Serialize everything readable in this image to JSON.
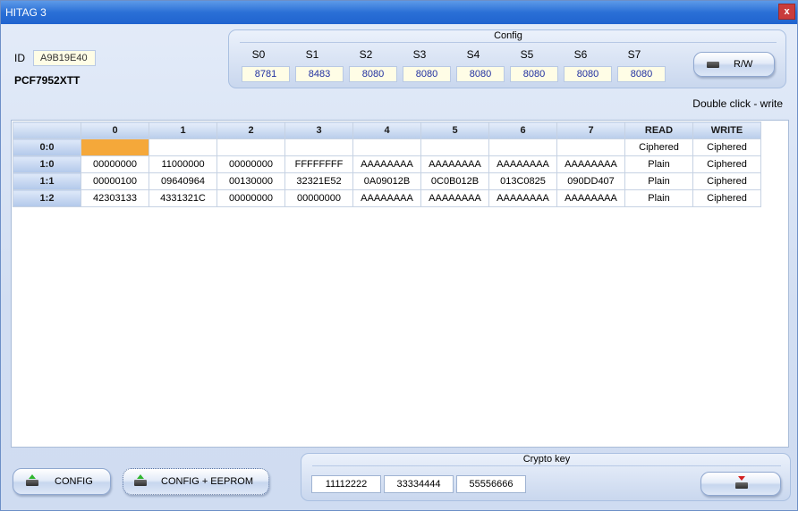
{
  "window": {
    "title": "HITAG 3",
    "close_label": "x"
  },
  "id_label": "ID",
  "id_value": "A9B19E40",
  "part_number": "PCF7952XTT",
  "config": {
    "title": "Config",
    "columns": [
      {
        "label": "S0",
        "value": "8781"
      },
      {
        "label": "S1",
        "value": "8483"
      },
      {
        "label": "S2",
        "value": "8080"
      },
      {
        "label": "S3",
        "value": "8080"
      },
      {
        "label": "S4",
        "value": "8080"
      },
      {
        "label": "S5",
        "value": "8080"
      },
      {
        "label": "S6",
        "value": "8080"
      },
      {
        "label": "S7",
        "value": "8080"
      }
    ],
    "rw_label": "R/W"
  },
  "hint": "Double click - write",
  "grid": {
    "headers": [
      "0",
      "1",
      "2",
      "3",
      "4",
      "5",
      "6",
      "7",
      "READ",
      "WRITE"
    ],
    "rows": [
      {
        "label": "0:0",
        "cells": [
          "",
          "",
          "",
          "",
          "",
          "",
          "",
          "",
          "Ciphered",
          "Ciphered"
        ]
      },
      {
        "label": "1:0",
        "cells": [
          "00000000",
          "11000000",
          "00000000",
          "FFFFFFFF",
          "AAAAAAAA",
          "AAAAAAAA",
          "AAAAAAAA",
          "AAAAAAAA",
          "Plain",
          "Ciphered"
        ]
      },
      {
        "label": "1:1",
        "cells": [
          "00000100",
          "09640964",
          "00130000",
          "32321E52",
          "0A09012B",
          "0C0B012B",
          "013C0825",
          "090DD407",
          "Plain",
          "Ciphered"
        ]
      },
      {
        "label": "1:2",
        "cells": [
          "42303133",
          "4331321C",
          "00000000",
          "00000000",
          "AAAAAAAA",
          "AAAAAAAA",
          "AAAAAAAA",
          "AAAAAAAA",
          "Plain",
          "Ciphered"
        ]
      }
    ]
  },
  "buttons": {
    "config": "CONFIG",
    "config_eeprom": "CONFIG + EEPROM"
  },
  "crypto": {
    "title": "Crypto key",
    "keys": [
      "11112222",
      "33334444",
      "55556666"
    ]
  },
  "icons": {
    "write": "write-icon",
    "read": "read-icon"
  },
  "colors": {
    "selected_cell": "#f5a83a",
    "titlebar": "#2a6fd6"
  }
}
